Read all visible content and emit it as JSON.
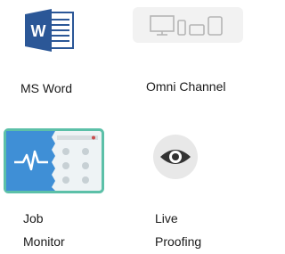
{
  "tiles": [
    {
      "id": "ms-word",
      "label": "MS Word",
      "icon": "ms-word-icon"
    },
    {
      "id": "omni-channel",
      "label": "Omni Channel",
      "icon": "devices-icon"
    },
    {
      "id": "job-monitor",
      "label_line1": "Job",
      "label_line2": "Monitor",
      "icon": "job-monitor-icon"
    },
    {
      "id": "live-proofing",
      "label_line1": "Live",
      "label_line2": "Proofing",
      "icon": "eye-icon"
    }
  ],
  "colors": {
    "word_blue": "#2b5797",
    "job_border": "#5cc0a8",
    "job_accent": "#3f8fd6",
    "eye_bg": "#e8e8e8",
    "eye_fg": "#333333"
  }
}
